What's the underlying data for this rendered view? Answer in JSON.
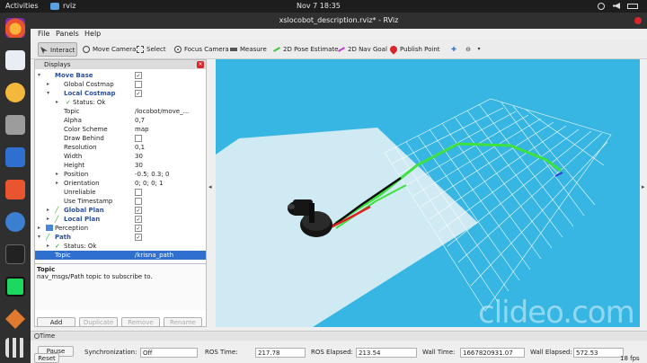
{
  "topbar": {
    "activities": "Activities",
    "app": "rviz",
    "clock": "Nov 7  18:35"
  },
  "window": {
    "title": "xslocobot_description.rviz* - RViz"
  },
  "menu": {
    "file": "File",
    "panels": "Panels",
    "help": "Help"
  },
  "toolbar": {
    "interact": "Interact",
    "move_camera": "Move Camera",
    "select": "Select",
    "focus_camera": "Focus Camera",
    "measure": "Measure",
    "pose_estimate": "2D Pose Estimate",
    "nav_goal": "2D Nav Goal",
    "publish_point": "Publish Point"
  },
  "displays": {
    "header": "Displays",
    "rows": [
      {
        "name": "Move Base",
        "value": "",
        "check": "✓"
      },
      {
        "name": "Global Costmap",
        "value": "",
        "check": ""
      },
      {
        "name": "Local Costmap",
        "value": "",
        "check": "✓"
      },
      {
        "name": "Status: Ok",
        "value": ""
      },
      {
        "name": "Topic",
        "value": "/locobot/move_..."
      },
      {
        "name": "Alpha",
        "value": "0,7"
      },
      {
        "name": "Color Scheme",
        "value": "map"
      },
      {
        "name": "Draw Behind",
        "value": "",
        "check": ""
      },
      {
        "name": "Resolution",
        "value": "0,1"
      },
      {
        "name": "Width",
        "value": "30"
      },
      {
        "name": "Height",
        "value": "30"
      },
      {
        "name": "Position",
        "value": "-0.5; 0.3; 0"
      },
      {
        "name": "Orientation",
        "value": "0; 0; 0; 1"
      },
      {
        "name": "Unreliable",
        "value": "",
        "check": ""
      },
      {
        "name": "Use Timestamp",
        "value": "",
        "check": ""
      },
      {
        "name": "Global Plan",
        "value": "",
        "check": "✓"
      },
      {
        "name": "Local Plan",
        "value": "",
        "check": "✓"
      },
      {
        "name": "Perception",
        "value": "",
        "check": "✓"
      },
      {
        "name": "Path",
        "value": "",
        "check": "✓"
      },
      {
        "name": "Status: Ok",
        "value": ""
      },
      {
        "name": "Topic",
        "value": "/krisna_path"
      }
    ],
    "desc_title": "Topic",
    "desc_text": "nav_msgs/Path topic to subscribe to.",
    "buttons": {
      "add": "Add",
      "duplicate": "Duplicate",
      "remove": "Remove",
      "rename": "Rename"
    }
  },
  "time": {
    "header": "Time",
    "pause": "Pause",
    "sync_label": "Synchronization:",
    "sync_value": "Off",
    "ros_time_label": "ROS Time:",
    "ros_time": "217.78",
    "ros_elapsed_label": "ROS Elapsed:",
    "ros_elapsed": "213.54",
    "wall_time_label": "Wall Time:",
    "wall_time": "1667820931.07",
    "wall_elapsed_label": "Wall Elapsed:",
    "wall_elapsed": "572.53",
    "reset": "Reset",
    "fps": "18 fps"
  },
  "watermark": "clideo.com",
  "colors": {
    "viewport": "#37b6e3",
    "selection": "#2f6fcf",
    "plan_green": "#3ee23e",
    "plan_red": "#e02020"
  }
}
